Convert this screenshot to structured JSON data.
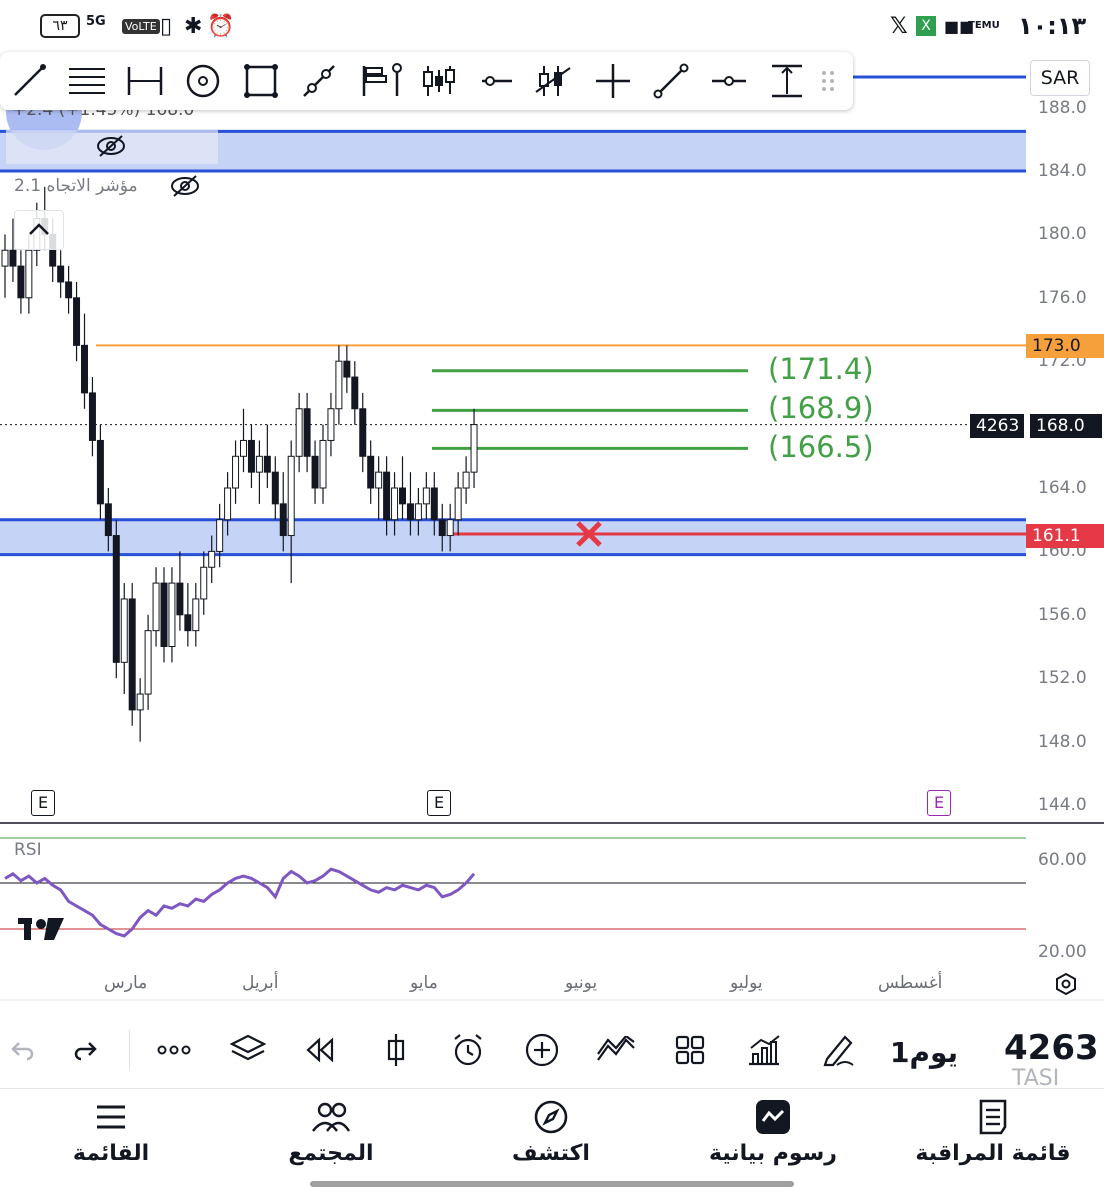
{
  "status_bar": {
    "time": "١٠:١٣",
    "battery": "٦٣",
    "network": "5G",
    "volte": "VoLTE",
    "icons": [
      "x-icon",
      "excel-icon",
      "app-icon",
      "temu-icon",
      "vibrate-icon",
      "bluetooth-icon",
      "alarm-icon"
    ]
  },
  "drawing_toolbar": {
    "tools": [
      "trend-line-icon",
      "horizontal-lines-icon",
      "date-range-icon",
      "circle-icon",
      "rectangle-icon",
      "path-icon",
      "flag-icon",
      "vertical-line-icon",
      "candles-icon",
      "horizontal-ray-icon",
      "bar-pattern-icon",
      "crosshair-icon",
      "ray-icon",
      "horizontal-segment-icon",
      "price-range-icon",
      "drag-handle-icon"
    ]
  },
  "currency": "SAR",
  "legend": {
    "change_text": "+2.4 (+1.45%)  168.0",
    "indicator_name": "مؤشر الاتجاه 2.1",
    "hidden_icon": "eye-crossed-icon"
  },
  "price_axis": [
    "188.0",
    "184.0",
    "180.0",
    "176.0",
    "172.0",
    "168.0",
    "164.0",
    "160.0",
    "156.0",
    "152.0",
    "148.0",
    "144.0"
  ],
  "price_tags": {
    "resistance": "173.0",
    "current_volume": "4263",
    "current_price": "168.0",
    "stop": "161.1"
  },
  "fib_targets": [
    "(171.4)",
    "(168.9)",
    "(166.5)"
  ],
  "colors": {
    "zone_fill": "#c5d3f7",
    "zone_border": "#2850d8",
    "resistance": "#f5a03a",
    "target": "#43a047",
    "stop": "#e53945",
    "rsi_line": "#7e57c2"
  },
  "rsi": {
    "label": "RSI",
    "axis": [
      "60.00",
      "20.00"
    ]
  },
  "months": [
    "مارس",
    "أبريل",
    "مايو",
    "يونيو",
    "يوليو",
    "أغسطس"
  ],
  "earnings_marker": "E",
  "chart_data": {
    "type": "candlestick",
    "symbol_volume": "4263",
    "last_price": 168.0,
    "ylim": [
      142,
      190
    ],
    "candles": [
      [
        178,
        180,
        176,
        179
      ],
      [
        179,
        181,
        177,
        178
      ],
      [
        178,
        179,
        175,
        176
      ],
      [
        176,
        180,
        175,
        179
      ],
      [
        179,
        182,
        178,
        181
      ],
      [
        181,
        183,
        179,
        180
      ],
      [
        180,
        181,
        177,
        178
      ],
      [
        178,
        179,
        176,
        177
      ],
      [
        177,
        178,
        175,
        176
      ],
      [
        176,
        177,
        172,
        173
      ],
      [
        173,
        175,
        169,
        170
      ],
      [
        170,
        171,
        166,
        167
      ],
      [
        167,
        168,
        162,
        163
      ],
      [
        163,
        164,
        160,
        161
      ],
      [
        161,
        162,
        152,
        153
      ],
      [
        153,
        158,
        151,
        157
      ],
      [
        157,
        158,
        149,
        150
      ],
      [
        150,
        152,
        148,
        151
      ],
      [
        151,
        156,
        150,
        155
      ],
      [
        155,
        159,
        154,
        158
      ],
      [
        158,
        159,
        153,
        154
      ],
      [
        154,
        159,
        153,
        158
      ],
      [
        158,
        160,
        155,
        156
      ],
      [
        156,
        158,
        154,
        155
      ],
      [
        155,
        158,
        154,
        157
      ],
      [
        157,
        160,
        156,
        159
      ],
      [
        159,
        161,
        158,
        160
      ],
      [
        160,
        163,
        159,
        162
      ],
      [
        162,
        165,
        161,
        164
      ],
      [
        164,
        167,
        163,
        166
      ],
      [
        166,
        169,
        165,
        167
      ],
      [
        167,
        168,
        164,
        165
      ],
      [
        165,
        167,
        163,
        166
      ],
      [
        166,
        168,
        164,
        165
      ],
      [
        165,
        166,
        162,
        163
      ],
      [
        163,
        165,
        160,
        161
      ],
      [
        161,
        167,
        158,
        166
      ],
      [
        166,
        170,
        165,
        169
      ],
      [
        169,
        170,
        165,
        166
      ],
      [
        166,
        167,
        163,
        164
      ],
      [
        164,
        168,
        163,
        167
      ],
      [
        167,
        170,
        166,
        169
      ],
      [
        169,
        173,
        168,
        172
      ],
      [
        172,
        173,
        170,
        171
      ],
      [
        171,
        172,
        168,
        169
      ],
      [
        169,
        170,
        165,
        166
      ],
      [
        166,
        167,
        163,
        164
      ],
      [
        164,
        166,
        162,
        165
      ],
      [
        165,
        166,
        161,
        162
      ],
      [
        162,
        165,
        161,
        164
      ],
      [
        164,
        166,
        162,
        163
      ],
      [
        163,
        165,
        161,
        162
      ],
      [
        162,
        164,
        161,
        163
      ],
      [
        163,
        165,
        162,
        164
      ],
      [
        164,
        165,
        161,
        162
      ],
      [
        162,
        163,
        160,
        161
      ],
      [
        161,
        163,
        160,
        162
      ],
      [
        162,
        165,
        161,
        164
      ],
      [
        164,
        166,
        163,
        165
      ],
      [
        165,
        169,
        164,
        168
      ]
    ],
    "levels": {
      "resistance": 173.0,
      "targets": [
        171.4,
        168.9,
        166.5
      ],
      "stop": 161.1,
      "zones": [
        [
          184.0,
          186.5
        ],
        [
          159.8,
          162.0
        ]
      ]
    },
    "rsi_values": [
      52,
      54,
      51,
      53,
      50,
      52,
      49,
      47,
      42,
      40,
      38,
      36,
      32,
      30,
      28,
      27,
      30,
      35,
      38,
      36,
      40,
      39,
      41,
      40,
      43,
      42,
      45,
      47,
      50,
      52,
      53,
      52,
      50,
      48,
      44,
      52,
      55,
      53,
      50,
      51,
      53,
      56,
      55,
      53,
      51,
      49,
      47,
      46,
      48,
      47,
      49,
      48,
      47,
      49,
      48,
      44,
      45,
      47,
      50,
      54
    ]
  },
  "action_bar": [
    "undo-icon",
    "redo-icon",
    "more-icon",
    "layers-icon",
    "replay-icon",
    "candle-type-icon",
    "alert-icon",
    "add-icon",
    "indicators-icon",
    "layout-icon",
    "financials-icon",
    "draw-icon"
  ],
  "ticker": {
    "symbol": "TASI",
    "volume": "4263",
    "interval": "1يوم"
  },
  "bottom_nav": [
    {
      "label": "القائمة",
      "icon": "menu-icon"
    },
    {
      "label": "المجتمع",
      "icon": "community-icon"
    },
    {
      "label": "اكتشف",
      "icon": "compass-icon"
    },
    {
      "label": "رسوم بيانية",
      "icon": "chart-icon"
    },
    {
      "label": "قائمة المراقبة",
      "icon": "watchlist-icon"
    }
  ]
}
